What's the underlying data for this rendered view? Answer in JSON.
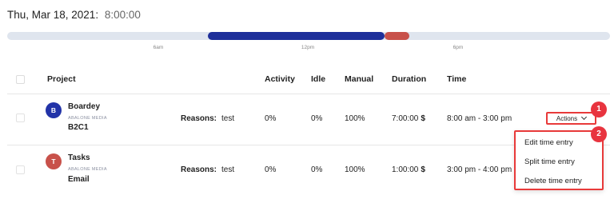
{
  "header": {
    "date": "Thu, Mar 18, 2021:",
    "total": "8:00:00"
  },
  "timeline": {
    "ticks": [
      "6am",
      "12pm",
      "6pm"
    ],
    "segments": [
      {
        "color": "#1e2f9a",
        "start": "8:00 am",
        "end": "3:00 pm"
      },
      {
        "color": "#c8514a",
        "start": "3:00 pm",
        "end": "4:00 pm"
      }
    ]
  },
  "table": {
    "columns": [
      "Project",
      "Activity",
      "Idle",
      "Manual",
      "Duration",
      "Time"
    ],
    "rows": [
      {
        "avatar": "B",
        "avatar_color": "#2233a8",
        "project": "Boardey",
        "client": "ABALONE MEDIA",
        "task": "B2C1",
        "reasons_label": "Reasons:",
        "reasons": "test",
        "activity": "0%",
        "idle": "0%",
        "manual": "100%",
        "duration": "7:00:00",
        "currency": "$",
        "time": "8:00 am - 3:00 pm"
      },
      {
        "avatar": "T",
        "avatar_color": "#c8514a",
        "project": "Tasks",
        "client": "ABALONE MEDIA",
        "task": "Email",
        "reasons_label": "Reasons:",
        "reasons": "test",
        "activity": "0%",
        "idle": "0%",
        "manual": "100%",
        "duration": "1:00:00",
        "currency": "$",
        "time": "3:00 pm - 4:00 pm"
      }
    ]
  },
  "actions": {
    "label": "Actions",
    "menu": [
      "Edit time entry",
      "Split time entry",
      "Delete time entry"
    ]
  },
  "annotations": {
    "badge_1": "1",
    "badge_2": "2",
    "color": "#e83a3a"
  }
}
